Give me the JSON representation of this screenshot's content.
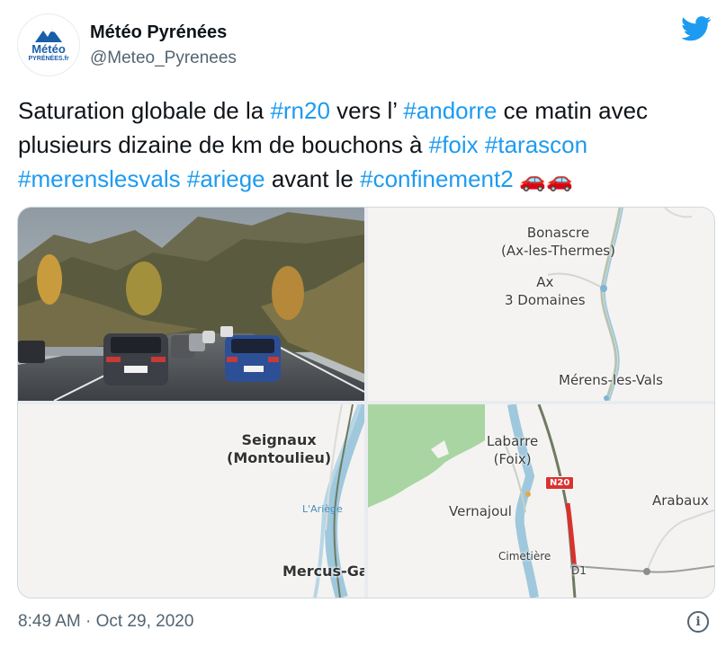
{
  "author": {
    "name": "Météo Pyrénées",
    "handle": "@Meteo_Pyrenees",
    "avatar_text": "Météo",
    "avatar_subtext": "PYRÉNÉES.fr"
  },
  "tweet": {
    "segments": [
      {
        "text": "Saturation globale de la ",
        "type": "text"
      },
      {
        "text": "#rn20",
        "type": "hashtag"
      },
      {
        "text": " vers l’ ",
        "type": "text"
      },
      {
        "text": "#andorre",
        "type": "hashtag"
      },
      {
        "text": " ce matin avec plusieurs dizaine de km de bouchons à ",
        "type": "text"
      },
      {
        "text": "#foix",
        "type": "hashtag"
      },
      {
        "text": " ",
        "type": "text"
      },
      {
        "text": "#tarascon",
        "type": "hashtag"
      },
      {
        "text": " ",
        "type": "text"
      },
      {
        "text": "#merenslesvals",
        "type": "hashtag"
      },
      {
        "text": " ",
        "type": "text"
      },
      {
        "text": "#ariege",
        "type": "hashtag"
      },
      {
        "text": " avant le ",
        "type": "text"
      },
      {
        "text": "#confinement2",
        "type": "hashtag"
      },
      {
        "text": " 🚗🚗",
        "type": "emoji"
      }
    ],
    "timestamp": "8:49 AM · Oct 29, 2020"
  },
  "map_top_right": {
    "labels": [
      "Bonascre\n(Ax-les-Thermes)",
      "Ax\n3 Domaines",
      "Mérens-les-Vals"
    ]
  },
  "map_bottom_left": {
    "labels": [
      "Seignaux\n(Montoulieu)",
      "Mercus-Ga"
    ],
    "water_label": "L'Ariège"
  },
  "map_bottom_right": {
    "labels": [
      "Labarre\n(Foix)",
      "Vernajoul",
      "Arabaux",
      "Cimetière"
    ],
    "road_shield": "N20",
    "road_label": "D1"
  },
  "colors": {
    "hashtag": "#1d9bf0",
    "secondary_text": "#536471",
    "traffic_red": "#d9322e",
    "twitter_blue": "#1d9bf0"
  }
}
